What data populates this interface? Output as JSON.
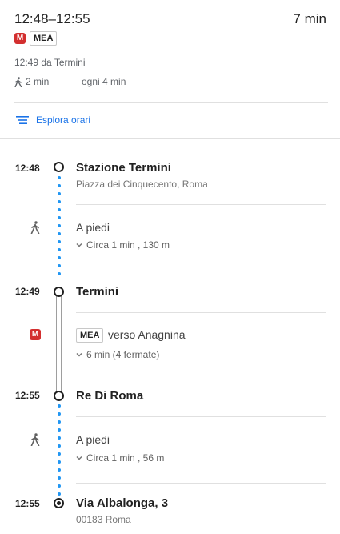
{
  "summary": {
    "time_range": "12:48–12:55",
    "duration": "7 min",
    "metro_icon": "M",
    "line": "MEA",
    "departure_info": "12:49 da Termini",
    "walk_time": "2 min",
    "frequency": "ogni 4 min"
  },
  "explore": {
    "label": "Esplora orari"
  },
  "timeline": {
    "stop1": {
      "time": "12:48",
      "name": "Stazione Termini",
      "address": "Piazza dei Cinquecento, Roma"
    },
    "walk1": {
      "title": "A piedi",
      "detail": "Circa 1 min , 130 m"
    },
    "stop2": {
      "time": "12:49",
      "name": "Termini"
    },
    "transit": {
      "line": "MEA",
      "direction": "verso Anagnina",
      "detail": "6 min (4 fermate)",
      "metro_icon": "M"
    },
    "stop3": {
      "time": "12:55",
      "name": "Re Di Roma"
    },
    "walk2": {
      "title": "A piedi",
      "detail": "Circa 1 min , 56 m"
    },
    "stop4": {
      "time": "12:55",
      "name": "Via Albalonga, 3",
      "address": "00183 Roma"
    }
  },
  "colors": {
    "metro_red": "#d32f2f",
    "walk_dots": "#2196f3",
    "link_blue": "#1a73e8"
  },
  "icons": [
    "metro-icon",
    "walk-icon",
    "list-icon",
    "chevron-down-icon"
  ]
}
